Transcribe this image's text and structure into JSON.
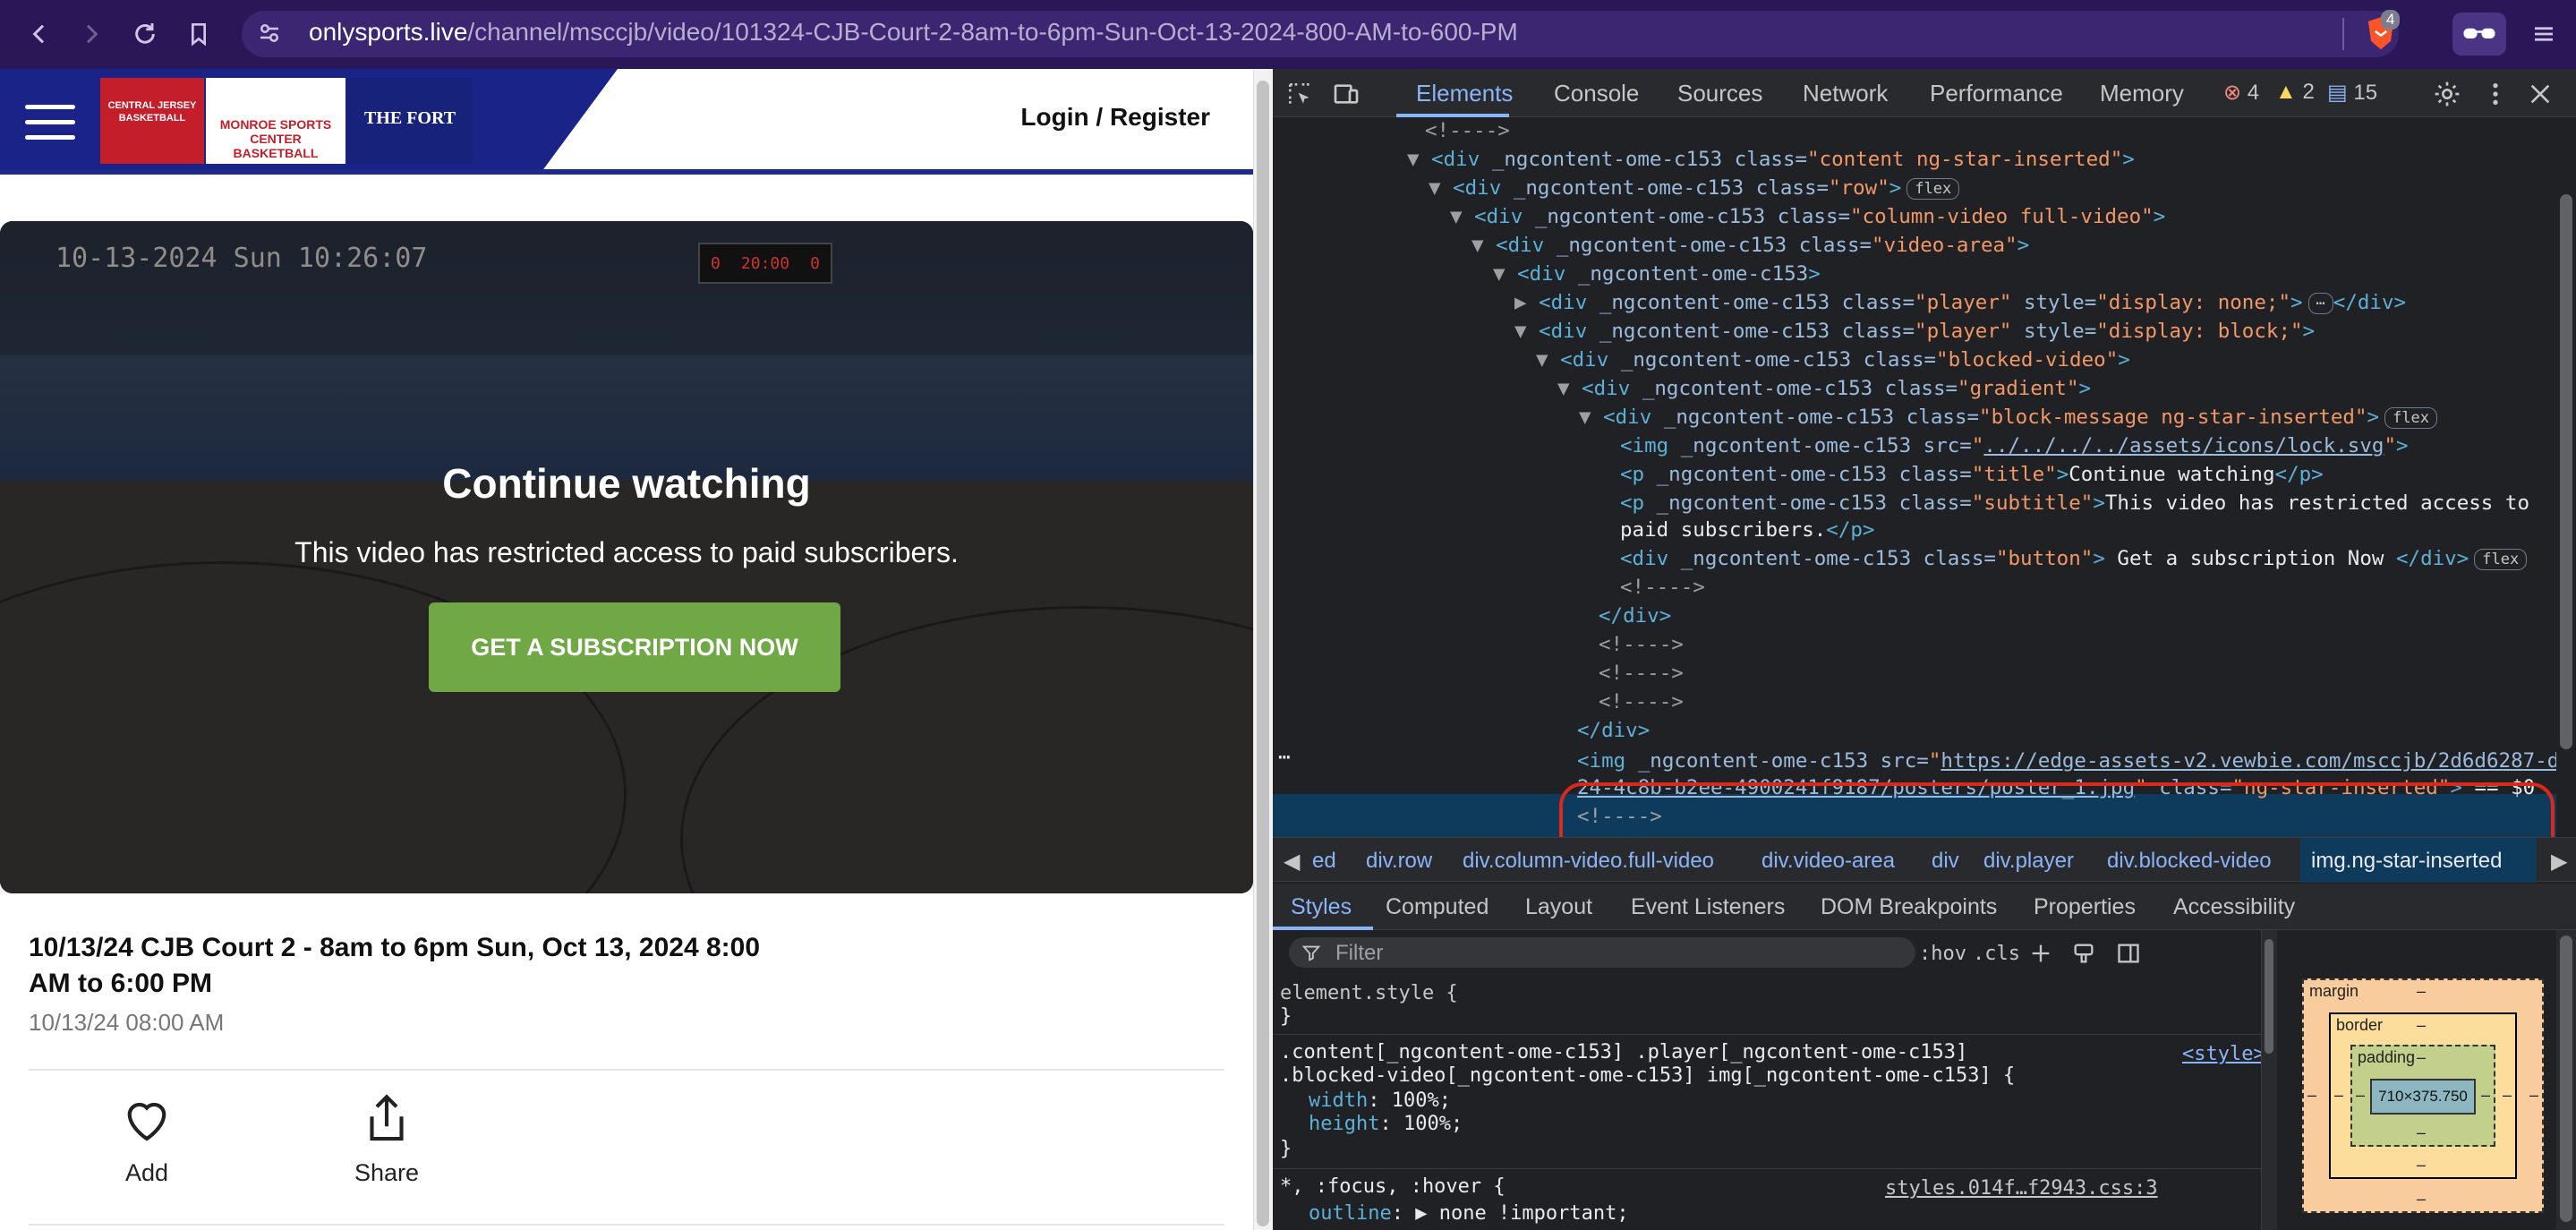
{
  "browser": {
    "url_host": "onlysports.live",
    "url_path": "/channel/msccjb/video/101324-CJB-Court-2-8am-to-6pm-Sun-Oct-13-2024-800-AM-to-600-PM",
    "shield_count": "4"
  },
  "site": {
    "logos": [
      "CENTRAL JERSEY BASKETBALL",
      "MONROE SPORTS CENTER BASKETBALL",
      "THE FORT"
    ],
    "login_label": "Login / Register"
  },
  "video": {
    "timestamp_overlay": "10-13-2024 Sun 10:26:07",
    "scoreboard_left": "0",
    "scoreboard_clock": "20:00",
    "scoreboard_right": "0",
    "block_title": "Continue watching",
    "block_subtitle": "This video has restricted access to paid subscribers.",
    "subscribe_label": "GET A SUBSCRIPTION NOW"
  },
  "details": {
    "title": "10/13/24 CJB Court 2 - 8am to 6pm Sun, Oct 13, 2024 8:00 AM to 6:00 PM",
    "date": "10/13/24 08:00 AM",
    "add_label": "Add",
    "share_label": "Share"
  },
  "devtools": {
    "tabs": [
      "Elements",
      "Console",
      "Sources",
      "Network",
      "Performance",
      "Memory"
    ],
    "error_count": "4",
    "warning_count": "2",
    "info_count": "15",
    "breadcrumbs": [
      "ed",
      "div.row",
      "div.column-video.full-video",
      "div.video-area",
      "div",
      "div.player",
      "div.blocked-video",
      "img.ng-star-inserted"
    ],
    "style_tabs": [
      "Styles",
      "Computed",
      "Layout",
      "Event Listeners",
      "DOM Breakpoints",
      "Properties",
      "Accessibility"
    ],
    "filter_placeholder": "Filter",
    "hov": ":hov",
    "cls": ".cls",
    "element_style": "element.style {",
    "rule_selector_1": ".content[_ngcontent-ome-c153] .player[_ngcontent-ome-c153]",
    "rule_selector_2": ".blocked-video[_ngcontent-ome-c153] img[_ngcontent-ome-c153] {",
    "rule_source": "<style>",
    "prop_width": "width",
    "val_width": "100%;",
    "prop_height": "height",
    "val_height": "100%;",
    "rule2_selector": "*, :focus, :hover {",
    "rule2_source": "styles.014f…f2943.css:3",
    "prop_outline": "outline",
    "val_outline": "none !important;",
    "box_margin": "margin",
    "box_border": "border",
    "box_padding": "padding",
    "box_content": "710×375.750",
    "dash": "–"
  },
  "colors": {
    "browser_bar": "#2a1758",
    "site_blue": "#1a2388",
    "subscribe_green": "#6fa845",
    "devtools_bg": "#202124",
    "highlight_red": "#d9281c"
  }
}
